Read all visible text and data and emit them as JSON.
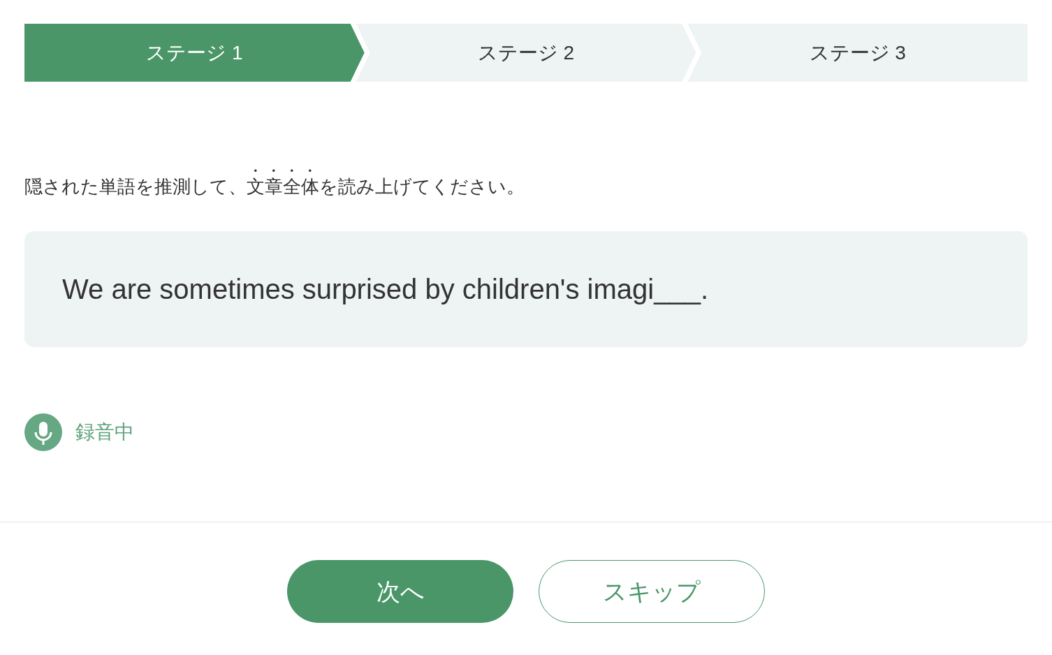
{
  "stages": [
    {
      "label": "ステージ 1",
      "selected": true
    },
    {
      "label": "ステージ 2",
      "selected": false
    },
    {
      "label": "ステージ 3",
      "selected": false
    }
  ],
  "instruction": {
    "before": "隠された単語を推測して、",
    "emphasis": "文章全体",
    "after": "を読み上げてください。"
  },
  "sentence": "We are sometimes surprised by children's imagi___.",
  "recording": {
    "label": "録音中"
  },
  "buttons": [
    {
      "label": "次へ",
      "kind": "primary"
    },
    {
      "label": "スキップ",
      "kind": "secondary"
    }
  ]
}
